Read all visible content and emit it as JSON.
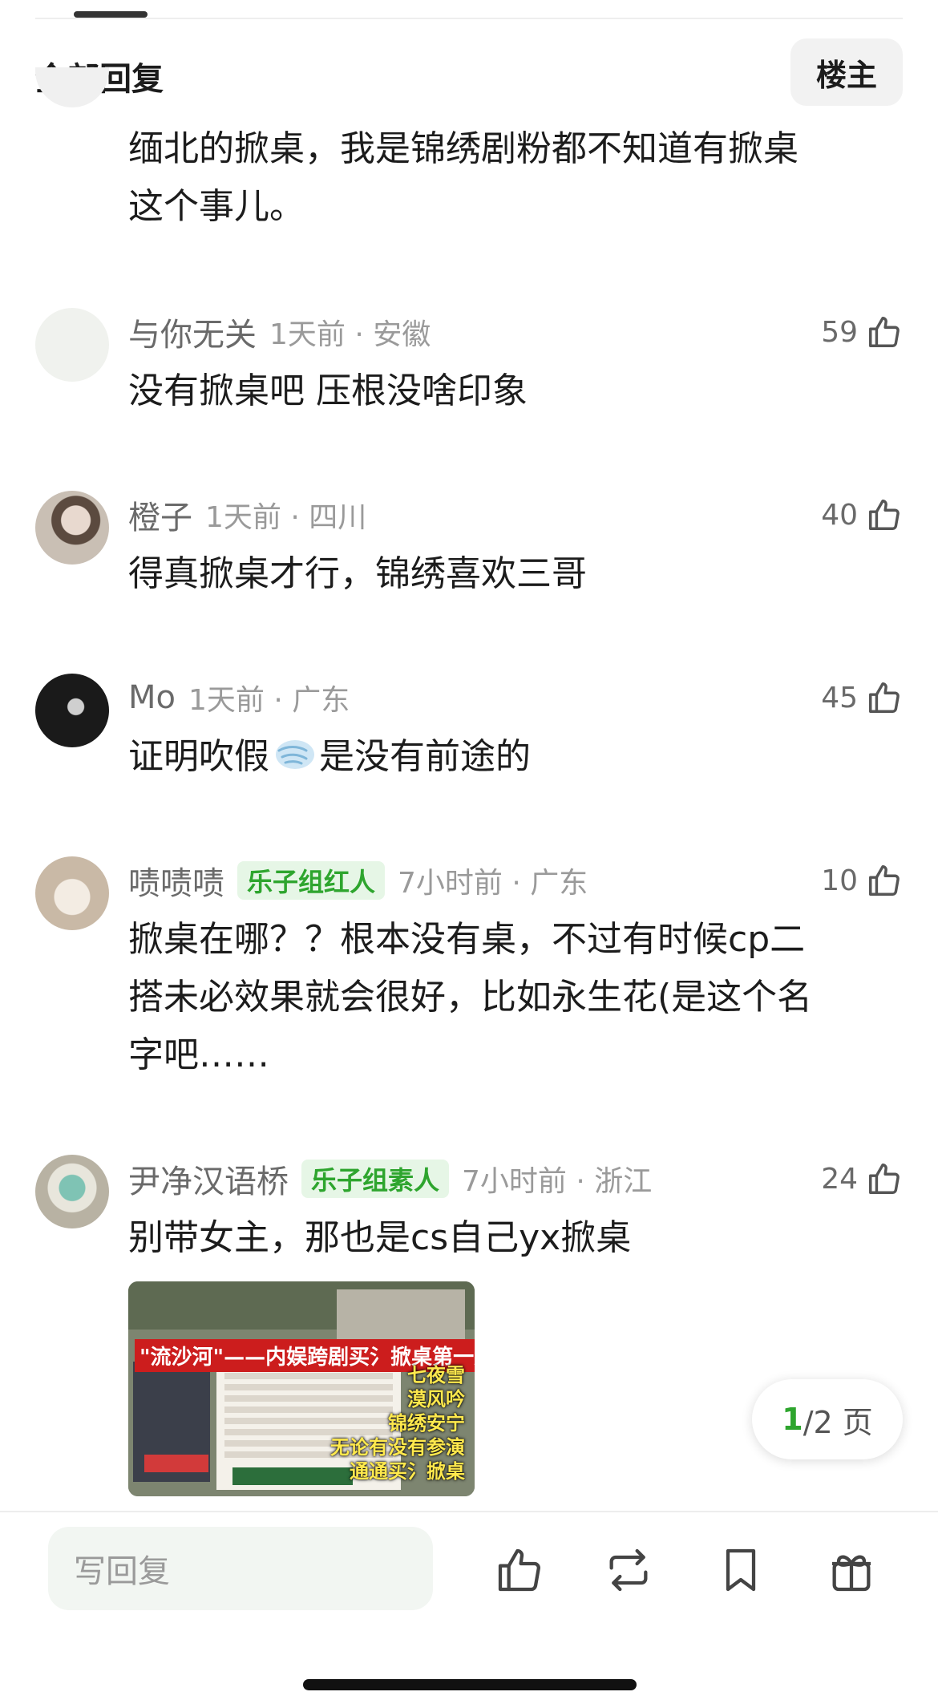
{
  "header": {
    "title": "全部回复",
    "op_button": "楼主"
  },
  "first_comment_tail": {
    "lines": [
      "缅北的掀桌，我是锦绣剧粉都不知道有掀桌",
      "这个事儿。"
    ]
  },
  "comments": [
    {
      "username": "与你无关",
      "time_location": "1天前 · 安徽",
      "likes": "59",
      "lines": [
        "没有掀桌吧 压根没啥印象"
      ]
    },
    {
      "username": "橙子",
      "time_location": "1天前 · 四川",
      "likes": "40",
      "lines": [
        "得真掀桌才行，锦绣喜欢三哥"
      ]
    },
    {
      "username": "Mo",
      "time_location": "1天前 · 广东",
      "likes": "45",
      "text_before_emoji": "证明吹假",
      "emoji": "wind-emoji",
      "text_after_emoji": "是没有前途的"
    },
    {
      "username": "啧啧啧",
      "badge": "乐子组红人",
      "time_location": "7小时前 · 广东",
      "likes": "10",
      "lines": [
        "掀桌在哪？？根本没有桌，不过有时候cp二",
        "搭未必效果就会很好，比如永生花(是这个名",
        "字吧……"
      ]
    },
    {
      "username": "尹净汉语桥",
      "badge": "乐子组素人",
      "time_location": "7小时前 · 浙江",
      "likes": "24",
      "lines": [
        "别带女主，那也是cs自己yx掀桌"
      ],
      "image": {
        "title": "\"流沙河\"——内娱跨剧买氵掀桌第一人",
        "side_lines": [
          "七夜雪",
          "漠风吟",
          "锦绣安宁",
          "无论有没有参演",
          "通通买氵掀桌"
        ]
      }
    }
  ],
  "pager": {
    "current": "1",
    "total": "/2 页"
  },
  "bottom_bar": {
    "reply_placeholder": "写回复",
    "icons": [
      "like-icon",
      "repost-icon",
      "bookmark-icon",
      "gift-icon"
    ]
  },
  "colors": {
    "accent_green": "#2ea52e",
    "badge_bg": "#e6f6e6"
  }
}
